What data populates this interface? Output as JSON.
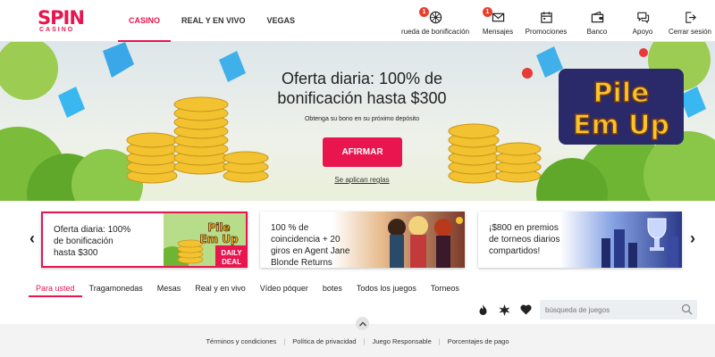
{
  "brand": {
    "logo_main": "SPIN",
    "logo_sub": "CASINO",
    "accent": "#e8154e"
  },
  "nav": [
    {
      "label": "CASINO",
      "active": true
    },
    {
      "label": "REAL Y EN VIVO",
      "active": false
    },
    {
      "label": "VEGAS",
      "active": false
    }
  ],
  "header_actions": [
    {
      "label": "rueda de bonificación",
      "icon": "wheel-icon",
      "badge": "1"
    },
    {
      "label": "Mensajes",
      "icon": "envelope-icon",
      "badge": "1"
    },
    {
      "label": "Promociones",
      "icon": "calendar-icon",
      "badge": ""
    },
    {
      "label": "Banco",
      "icon": "wallet-icon",
      "badge": ""
    },
    {
      "label": "Apoyo",
      "icon": "chat-icon",
      "badge": ""
    },
    {
      "label": "Cerrar sesión",
      "icon": "logout-icon",
      "badge": ""
    }
  ],
  "hero": {
    "title_line1": "Oferta diaria: 100% de",
    "title_line2": "bonificación hasta $300",
    "subtitle": "Obtenga su bono en su próximo depósito",
    "cta": "AFIRMAR",
    "terms": "Se aplican reglas",
    "game_logo_line1": "Pile",
    "game_logo_line2": "Em Up"
  },
  "promos": [
    {
      "line1": "Oferta diaria: 100%",
      "line2": "de bonificación",
      "line3": "hasta $300",
      "logo1": "Pile",
      "logo2": "Em Up",
      "tag1": "DAILY",
      "tag2": "DEAL"
    },
    {
      "line1": "100 % de",
      "line2": "coincidencia + 20",
      "line3": "giros en Agent Jane",
      "line4": "Blonde Returns"
    },
    {
      "line1": "¡$800 en premios",
      "line2": "de torneos diarios",
      "line3": "compartidos!"
    }
  ],
  "tabs": [
    {
      "label": "Para usted",
      "active": true
    },
    {
      "label": "Tragamonedas",
      "active": false
    },
    {
      "label": "Mesas",
      "active": false
    },
    {
      "label": "Real y en vivo",
      "active": false
    },
    {
      "label": "Vídeo póquer",
      "active": false
    },
    {
      "label": "botes",
      "active": false
    },
    {
      "label": "Todos los juegos",
      "active": false
    },
    {
      "label": "Torneos",
      "active": false
    }
  ],
  "search": {
    "placeholder": "búsqueda de juegos"
  },
  "tool_icons": [
    "flame-icon",
    "star-burst-icon",
    "heart-icon"
  ],
  "footer_links": [
    "Términos y condiciones",
    "Política de privacidad",
    "Juego Responsable",
    "Porcentajes de pago"
  ]
}
